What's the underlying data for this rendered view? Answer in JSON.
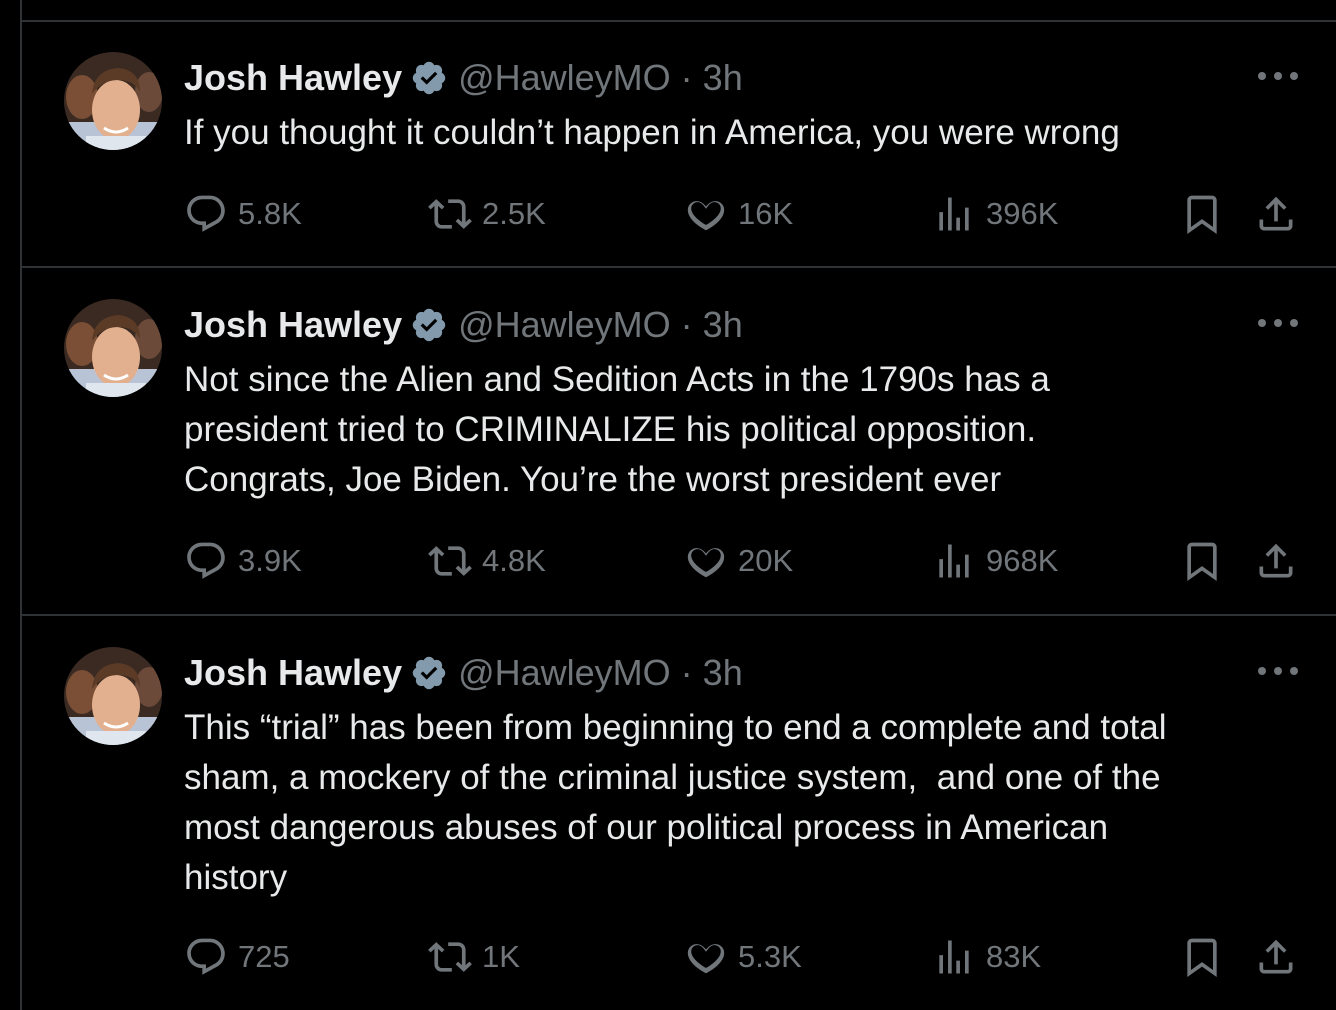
{
  "tweets": [
    {
      "author": "Josh Hawley",
      "handle": "@HawleyMO",
      "separator": "·",
      "time": "3h",
      "text": "If you thought it couldn’t happen in America, you were wrong",
      "replies": "5.8K",
      "retweets": "2.5K",
      "likes": "16K",
      "views": "396K"
    },
    {
      "author": "Josh Hawley",
      "handle": "@HawleyMO",
      "separator": "·",
      "time": "3h",
      "text": "Not since the Alien and Sedition Acts in the 1790s has a\npresident tried to CRIMINALIZE his political opposition.\nCongrats, Joe Biden. You’re the worst president ever",
      "replies": "3.9K",
      "retweets": "4.8K",
      "likes": "20K",
      "views": "968K"
    },
    {
      "author": "Josh Hawley",
      "handle": "@HawleyMO",
      "separator": "·",
      "time": "3h",
      "text": "This “trial” has been from beginning to end a complete and total\nsham, a mockery of the criminal justice system,  and one of the\nmost dangerous abuses of our political process in American\nhistory",
      "replies": "725",
      "retweets": "1K",
      "likes": "5.3K",
      "views": "83K"
    }
  ],
  "colors": {
    "background": "#000000",
    "text": "#e7e9ea",
    "muted": "#71767b",
    "divider": "#2f3336",
    "verified": "#829aab"
  },
  "icons": [
    "reply-icon",
    "retweet-icon",
    "like-icon",
    "views-icon",
    "bookmark-icon",
    "share-icon",
    "verified-badge-icon",
    "more-icon"
  ]
}
